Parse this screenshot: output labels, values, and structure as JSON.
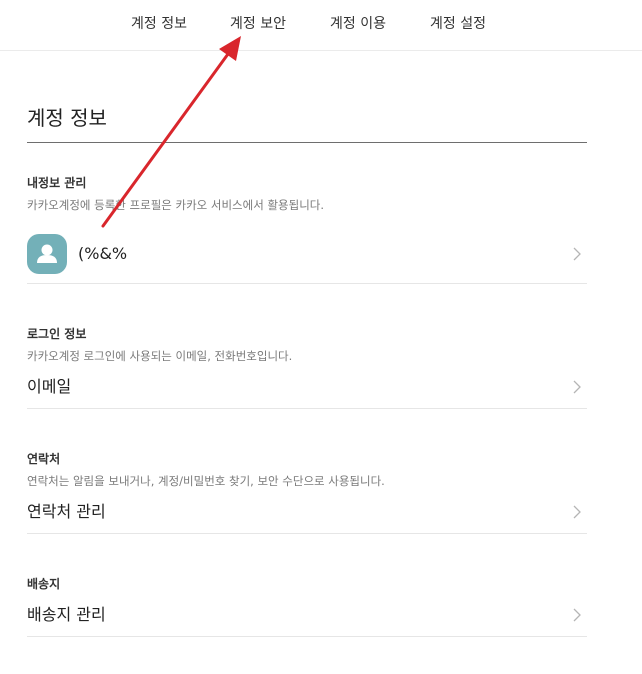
{
  "tabs": [
    {
      "label": "계정 정보"
    },
    {
      "label": "계정 보안"
    },
    {
      "label": "계정 이용"
    },
    {
      "label": "계정 설정"
    }
  ],
  "page_title": "계정 정보",
  "sections": {
    "profile": {
      "heading": "내정보 관리",
      "description": "카카오계정에 등록한 프로필은 카카오 서비스에서 활용됩니다.",
      "name": "(%&%"
    },
    "login": {
      "heading": "로그인 정보",
      "description": "카카오계정 로그인에 사용되는 이메일, 전화번호입니다.",
      "row_label": "이메일"
    },
    "contact": {
      "heading": "연락처",
      "description": "연락처는 알림을 보내거나, 계정/비밀번호 찾기, 보안 수단으로 사용됩니다.",
      "row_label": "연락처 관리"
    },
    "shipping": {
      "heading": "배송지",
      "row_label": "배송지 관리"
    }
  },
  "colors": {
    "annotation_arrow": "#d9262c",
    "avatar_bg": "#73b0b8"
  },
  "icons": [
    "chevron-right-icon",
    "user-silhouette-icon"
  ]
}
